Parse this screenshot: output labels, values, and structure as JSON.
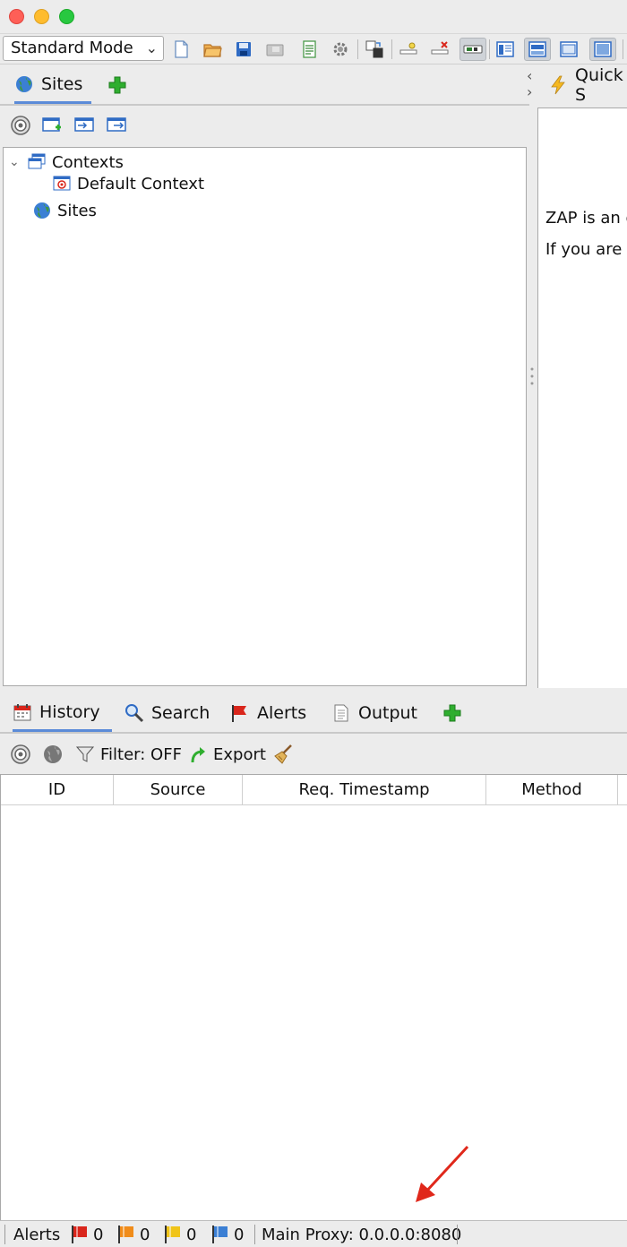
{
  "toolbar": {
    "mode_label": "Standard Mode",
    "icons": [
      "new-session-icon",
      "open-session-icon",
      "save-session-icon",
      "snapshot-icon",
      "session-properties-icon",
      "options-icon",
      "layout-icon",
      "breakpoint-icon",
      "remove-breakpoint-icon",
      "manual-request-icon",
      "layout-full-icon",
      "layout-tabs-icon",
      "layout-side-icon",
      "layout-maximize-icon"
    ]
  },
  "sites_panel": {
    "tab_label": "Sites",
    "tree": {
      "contexts_label": "Contexts",
      "default_context_label": "Default Context",
      "sites_label": "Sites"
    }
  },
  "quick_start": {
    "tab_label": "Quick S",
    "line1": "ZAP is an e",
    "line2": "If you are n"
  },
  "bottom_panel": {
    "tabs": [
      {
        "label": "History"
      },
      {
        "label": "Search"
      },
      {
        "label": "Alerts"
      },
      {
        "label": "Output"
      }
    ],
    "filter_label": "Filter: OFF",
    "export_label": "Export",
    "columns": [
      "ID",
      "Source",
      "Req. Timestamp",
      "Method"
    ]
  },
  "statusbar": {
    "alerts_label": "Alerts",
    "high_count": "0",
    "medium_count": "0",
    "low_count": "0",
    "info_count": "0",
    "proxy_label": "Main Proxy: 0.0.0.0:8080"
  },
  "colors": {
    "accent": "#5b8bd8",
    "annotation_arrow": "#e0281b",
    "flag_high": "#d9261c",
    "flag_medium": "#f08c1a",
    "flag_low": "#f0c419",
    "flag_info": "#3b7fd4"
  }
}
